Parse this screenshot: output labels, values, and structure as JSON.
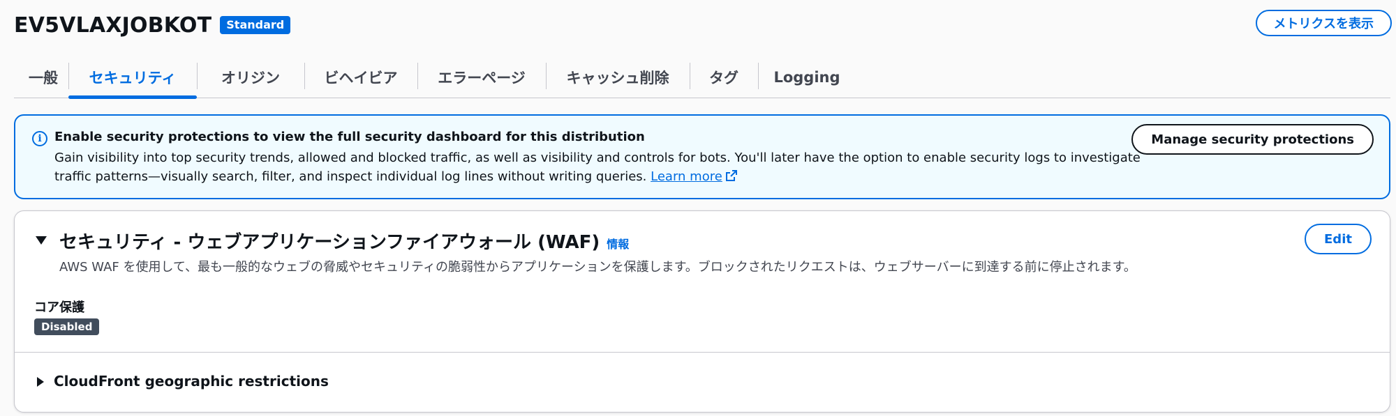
{
  "header": {
    "title": "EV5VLAXJOBKOT",
    "badge": "Standard",
    "metrics_button": "メトリクスを表示"
  },
  "tabs": [
    {
      "label": "一般",
      "active": false
    },
    {
      "label": "セキュリティ",
      "active": true
    },
    {
      "label": "オリジン",
      "active": false
    },
    {
      "label": "ビヘイビア",
      "active": false
    },
    {
      "label": "エラーページ",
      "active": false
    },
    {
      "label": "キャッシュ削除",
      "active": false
    },
    {
      "label": "タグ",
      "active": false
    },
    {
      "label": "Logging",
      "active": false
    }
  ],
  "alert": {
    "icon": "info-circle-icon",
    "title": "Enable security protections to view the full security dashboard for this distribution",
    "body": "Gain visibility into top security trends, allowed and blocked traffic, as well as visibility and controls for bots. You'll later have the option to enable security logs to investigate traffic patterns—visually search, filter, and inspect individual log lines without writing queries.",
    "link": "Learn more",
    "button": "Manage security protections"
  },
  "waf": {
    "title": "セキュリティ - ウェブアプリケーションファイアウォール (WAF)",
    "info_link": "情報",
    "description": "AWS WAF を使用して、最も一般的なウェブの脅威やセキュリティの脆弱性からアプリケーションを保護します。ブロックされたリクエストは、ウェブサーバーに到達する前に停止されます。",
    "edit_button": "Edit",
    "core_label": "コア保護",
    "core_status": "Disabled"
  },
  "geo": {
    "title": "CloudFront geographic restrictions"
  },
  "colors": {
    "accent": "#006ce0",
    "alert_bg": "#f0fbff",
    "badge_disabled": "#414d5c"
  }
}
